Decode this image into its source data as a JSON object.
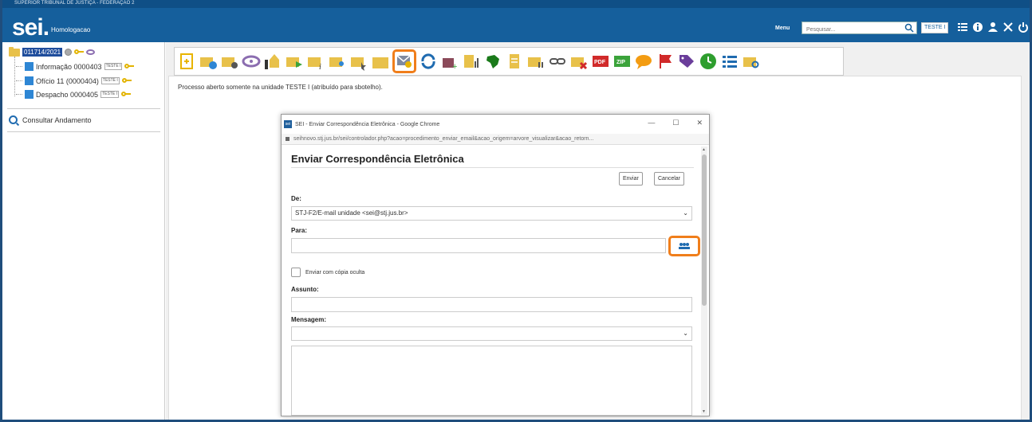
{
  "header": {
    "court_title": "SUPERIOR TRIBUNAL DE JUSTIÇA - FEDERAÇÃO 2",
    "logo": "sei.",
    "environment": "Homologacao",
    "menu_label": "Menu",
    "search_placeholder": "Pesquisar...",
    "unit_button": "TESTE I",
    "icons": [
      "grid-icon",
      "info-icon",
      "user-icon",
      "tools-icon",
      "power-icon"
    ]
  },
  "tree": {
    "process_number": "011714/2021",
    "documents": [
      {
        "label": "Informação 0000403",
        "tag": "TESTE I"
      },
      {
        "label": "Ofício 11 (0000404)",
        "tag": "TESTE I"
      },
      {
        "label": "Despacho 0000405",
        "tag": "TESTE I"
      }
    ],
    "consult_label": "Consultar Andamento"
  },
  "toolbar": {
    "icons": [
      "new-document-icon",
      "process-relation-icon",
      "process-settings-icon",
      "view-icon",
      "sign-icon",
      "send-process-icon",
      "edit-process-icon",
      "assign-icon",
      "bookmark-icon",
      "folder-icon",
      "email-icon",
      "refresh-icon",
      "attach-icon",
      "stats-icon",
      "brazil-map-icon",
      "document-lines-icon",
      "archive-icon",
      "link-icon",
      "delete-icon",
      "pdf-icon",
      "zip-icon",
      "comment-icon",
      "flag-icon",
      "tag-icon",
      "clock-icon",
      "list-icon",
      "search-folder-icon"
    ],
    "highlighted_index": 10
  },
  "main": {
    "status_text": "Processo aberto somente na unidade TESTE I (atribuído para sbotelho)."
  },
  "popup": {
    "window_title": "SEI - Enviar Correspondência Eletrônica - Google Chrome",
    "favicon_text": "sei",
    "address": "seihnovo.stj.jus.br/sei/controlador.php?acao=procedimento_enviar_email&acao_origem=arvore_visualizar&acao_retorn...",
    "heading": "Enviar Correspondência Eletrônica",
    "send_button": "Enviar",
    "cancel_button": "Cancelar",
    "from_label": "De:",
    "from_value": "STJ-F2/E-mail unidade <sei@stj.jus.br>",
    "to_label": "Para:",
    "bcc_label": "Enviar com cópia oculta",
    "subject_label": "Assunto:",
    "message_label": "Mensagem:",
    "window_controls": [
      "—",
      "☐",
      "✕"
    ]
  },
  "colors": {
    "header_blue": "#155f9c",
    "highlight_orange": "#f07e1b"
  }
}
